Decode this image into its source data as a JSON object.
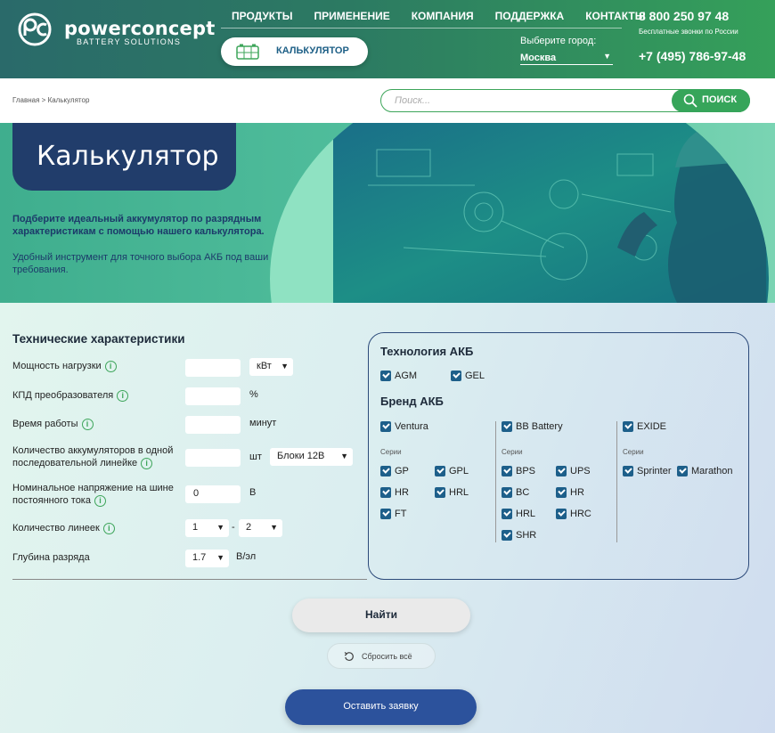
{
  "header": {
    "brand": "powerconcept",
    "brand_sub": "BATTERY SOLUTIONS",
    "nav": [
      "ПРОДУКТЫ",
      "ПРИМЕНЕНИЕ",
      "КОМПАНИЯ",
      "ПОДДЕРЖКА",
      "КОНТАКТЫ"
    ],
    "calc_label": "КАЛЬКУЛЯТОР",
    "city_label": "Выберите город:",
    "city_value": "Москва",
    "phone1": "8 800 250 97 48",
    "phone_note": "Бесплатные звонки по России",
    "phone2": "+7 (495) 786-97-48"
  },
  "breadcrumb": "Главная > Калькулятор",
  "search": {
    "placeholder": "Поиск...",
    "button": "ПОИСК"
  },
  "hero": {
    "title": "Калькулятор",
    "text1": "Подберите идеальный аккумулятор по разрядным характеристикам с помощью нашего калькулятора.",
    "text2": "Удобный инструмент для точного выбора АКБ под ваши требования."
  },
  "tech": {
    "title": "Технические характеристики",
    "power_label": "Мощность нагрузки",
    "power_unit": "кВт",
    "eff_label": "КПД преобразователя",
    "eff_unit": "%",
    "time_label": "Время работы",
    "time_unit": "минут",
    "count_label": "Количество аккумуляторов в одной последовательной линейке",
    "count_unit": "шт",
    "block_value": "Блоки 12В",
    "voltage_label": "Номинальное напряжение на шине постоянного тока",
    "voltage_value": "0",
    "voltage_unit": "В",
    "lines_label": "Количество линеек",
    "lines_from": "1",
    "lines_sep": "-",
    "lines_to": "2",
    "depth_label": "Глубина разряда",
    "depth_value": "1.7",
    "depth_unit": "В/эл"
  },
  "panel": {
    "tech_title": "Технология АКБ",
    "tech_items": [
      "AGM",
      "GEL"
    ],
    "brand_title": "Бренд АКБ",
    "series_label": "Серии",
    "brands": [
      {
        "name": "Ventura",
        "series": [
          "GP",
          "GPL",
          "HR",
          "HRL",
          "FT"
        ]
      },
      {
        "name": "BB Battery",
        "series": [
          "BPS",
          "UPS",
          "BC",
          "HR",
          "HRL",
          "HRC",
          "SHR"
        ]
      },
      {
        "name": "EXIDE",
        "series": [
          "Sprinter",
          "Marathon"
        ]
      }
    ]
  },
  "buttons": {
    "find": "Найти",
    "reset": "Сбросить всё",
    "request": "Оставить заявку"
  }
}
